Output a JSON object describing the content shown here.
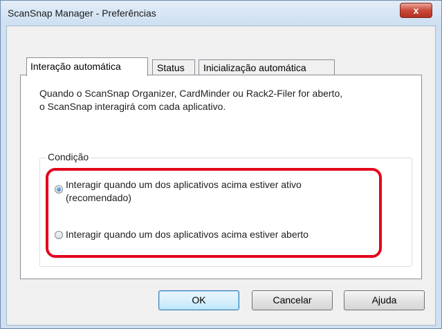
{
  "window": {
    "title": "ScanSnap Manager - Preferências",
    "close_label": "x"
  },
  "tabs": [
    {
      "label": "Interação automática",
      "active": true
    },
    {
      "label": "Status",
      "active": false
    },
    {
      "label": "Inicialização automática",
      "active": false
    }
  ],
  "description": {
    "line1": "Quando o ScanSnap Organizer, CardMinder ou Rack2-Filer for aberto,",
    "line2": "o ScanSnap interagirá com cada aplicativo."
  },
  "condition": {
    "legend": "Condição",
    "options": [
      {
        "line1": "Interagir quando um dos aplicativos acima estiver ativo",
        "line2": "(recomendado)",
        "checked": true
      },
      {
        "line1": "Interagir quando um dos aplicativos acima estiver aberto",
        "line2": "",
        "checked": false
      }
    ]
  },
  "buttons": {
    "ok": "OK",
    "cancel": "Cancelar",
    "help": "Ajuda"
  },
  "colors": {
    "highlight": "#e3001b",
    "close_button": "#c9493a",
    "default_button_border": "#3c7fb1"
  }
}
